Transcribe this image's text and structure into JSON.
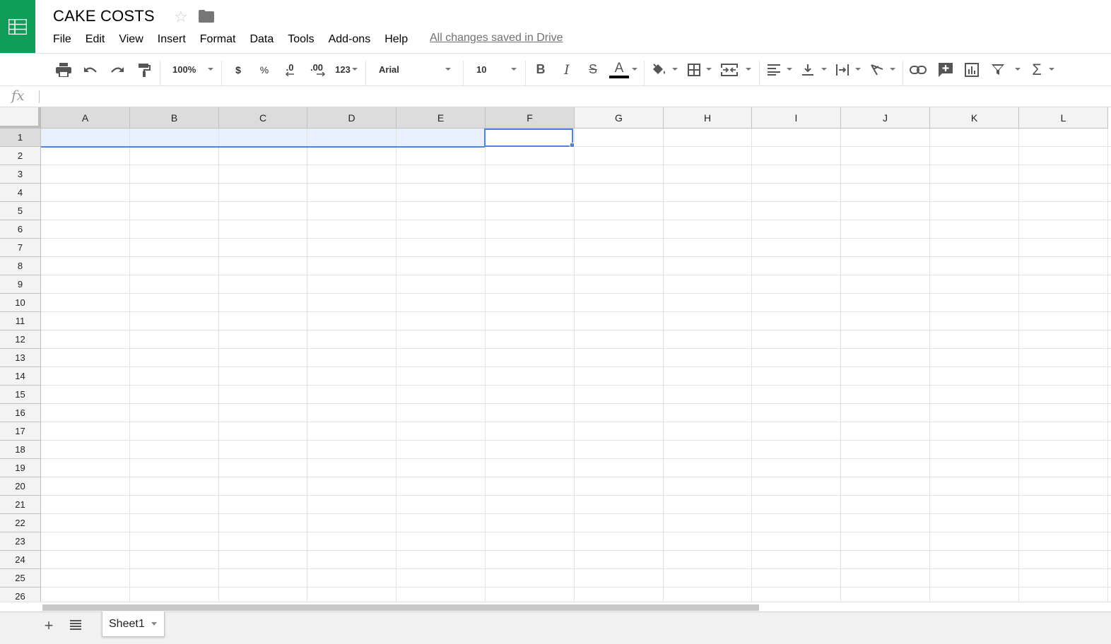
{
  "app": {
    "title": "CAKE COSTS",
    "save_status": "All changes saved in Drive",
    "brand_color": "#0f9d58",
    "accent_color": "#4a86e8"
  },
  "menu": [
    "File",
    "Edit",
    "View",
    "Insert",
    "Format",
    "Data",
    "Tools",
    "Add-ons",
    "Help"
  ],
  "toolbar": {
    "zoom": "100%",
    "currency": "$",
    "percent": "%",
    "decrease_decimal": ".0",
    "increase_decimal": ".00",
    "more_formats": "123",
    "font_family": "Arial",
    "font_size": "10",
    "bold": "B",
    "italic": "I",
    "strikethrough": "S",
    "text_color": "A"
  },
  "formula_bar": {
    "label": "fx",
    "value": ""
  },
  "grid": {
    "columns": [
      "A",
      "B",
      "C",
      "D",
      "E",
      "F",
      "G",
      "H",
      "I",
      "J",
      "K",
      "L"
    ],
    "rows": [
      "1",
      "2",
      "3",
      "4",
      "5",
      "6",
      "7",
      "8",
      "9",
      "10",
      "11",
      "12",
      "13",
      "14",
      "15",
      "16",
      "17",
      "18",
      "19",
      "20",
      "21",
      "22",
      "23",
      "24",
      "25",
      "26"
    ],
    "active_cell": "F1"
  },
  "sheets": {
    "add_label": "+",
    "tabs": [
      {
        "label": "Sheet1"
      }
    ]
  }
}
